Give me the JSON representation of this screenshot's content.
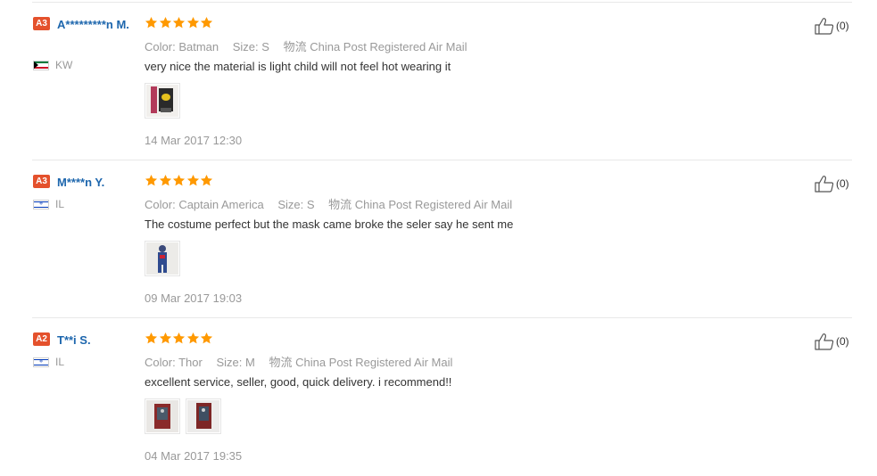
{
  "reviews": [
    {
      "level": "A3",
      "user": "A*********n M.",
      "country_code": "KW",
      "flag": "kuwait-flag",
      "stars": 5,
      "color_label": "Color:",
      "color_value": "Batman",
      "size_label": "Size:",
      "size_value": "S",
      "shipping_label": "物流",
      "shipping_value": "China Post Registered Air Mail",
      "text": "very nice the material is light child will not feel hot wearing it",
      "photos": [
        "batman-costume-photo"
      ],
      "date": "14 Mar 2017 12:30",
      "helpful_count": "(0)"
    },
    {
      "level": "A3",
      "user": "M****n Y.",
      "country_code": "IL",
      "flag": "israel-flag",
      "stars": 5,
      "color_label": "Color:",
      "color_value": "Captain America",
      "size_label": "Size:",
      "size_value": "S",
      "shipping_label": "物流",
      "shipping_value": "China Post Registered Air Mail",
      "text": "The costume perfect but the mask came broke the seler say he sent me",
      "photos": [
        "captain-america-costume-photo"
      ],
      "date": "09 Mar 2017 19:03",
      "helpful_count": "(0)"
    },
    {
      "level": "A2",
      "user": "T**i S.",
      "country_code": "IL",
      "flag": "israel-flag",
      "stars": 5,
      "color_label": "Color:",
      "color_value": "Thor",
      "size_label": "Size:",
      "size_value": "M",
      "shipping_label": "物流",
      "shipping_value": "China Post Registered Air Mail",
      "text": "excellent service, seller, good, quick delivery. i recommend!!",
      "photos": [
        "thor-costume-photo-1",
        "thor-costume-photo-2"
      ],
      "date": "04 Mar 2017 19:35",
      "helpful_count": "(0)"
    }
  ],
  "colors": {
    "star": "#f90",
    "username": "#1d66ad",
    "level_badge": "#e4512c",
    "muted": "#999999"
  }
}
